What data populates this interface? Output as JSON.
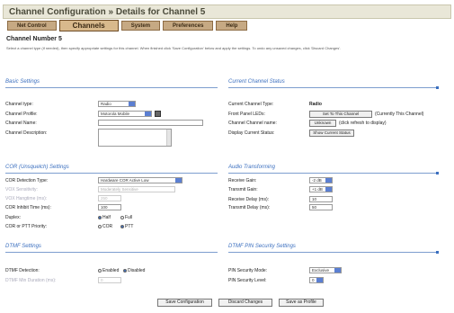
{
  "page": {
    "title": "Channel Configuration  »  Details for Channel 5",
    "heading": "Channel Number 5",
    "intro": "Select a channel type (if needed), then specify appropriate settings for this channel. When finished click 'Save Configuration' below and apply the settings. To undo any unsaved changes, click 'Discard Changes'."
  },
  "tabs": [
    {
      "label": "Net Control"
    },
    {
      "label": "Channels"
    },
    {
      "label": "System"
    },
    {
      "label": "Preferences"
    },
    {
      "label": "Help"
    }
  ],
  "basic": {
    "heading": "Basic Settings",
    "type_label": "Channel type:",
    "type_value": "Radio",
    "profile_label": "Channel Profile:",
    "profile_value": "Motorola Mobile",
    "name_label": "Channel Name:",
    "name_value": "",
    "desc_label": "Channel Description:"
  },
  "status": {
    "heading": "Current Channel Status",
    "type_label": "Current Channel Type:",
    "type_value": "Radio",
    "led_label": "Front Panel LEDs:",
    "led_button": "Set To This Channel",
    "led_note": "(Currently This Channel)",
    "name_label": "Channel Channel name:",
    "name_button": "Unknown",
    "name_note": "(click refresh to display)",
    "display_label": "Display Current Status:",
    "display_button": "Show Current Status"
  },
  "cor": {
    "heading": "COR (Unsquelch) Settings",
    "type_label": "COR Detection Type:",
    "type_value": "Hardware COR Active Low",
    "sens_label": "VOX Sensitivity:",
    "sens_value": "Moderately Sensitive",
    "hang_label": "VOX Hangtime (ms):",
    "hang_value": "250",
    "inhibit_label": "COR Inhibit Time (ms):",
    "inhibit_value": "100",
    "duplex_label": "Duplex:",
    "duplex_half": "Half",
    "duplex_full": "Full",
    "priority_label": "COR or PTT Priority:",
    "priority_cor": "COR",
    "priority_ptt": "PTT"
  },
  "audio": {
    "heading": "Audio Transforming",
    "rx_label": "Receive Gain:",
    "rx_value": "-2 dB",
    "tx_label": "Transmit Gain:",
    "tx_value": "+1 dB",
    "rxd_label": "Receive Delay (ms):",
    "rxd_value": "10",
    "txd_label": "Transmit Delay (ms):",
    "txd_value": "50"
  },
  "dtmf": {
    "heading": "DTMF Settings",
    "det_label": "DTMF Detection:",
    "enabled": "Enabled",
    "disabled": "Disabled",
    "dur_label": "DTMF Min Duration (ms):",
    "dur_value": "0"
  },
  "pin": {
    "heading": "DTMF PIN Security Settings",
    "mode_label": "PIN Security Mode:",
    "mode_value": "Exclusive",
    "level_label": "PIN Security Level:",
    "level_value": "0"
  },
  "footer": {
    "save": "Save Configuration",
    "discard": "Discard Changes",
    "profile": "Save as Profile"
  },
  "colors": {
    "section_heading": "#3b6fbf",
    "tab_fill": "#c6a983",
    "title_bar": "#e9e7d8"
  }
}
